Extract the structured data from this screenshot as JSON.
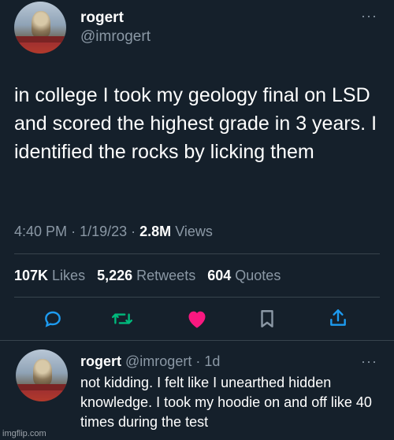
{
  "tweet": {
    "display_name": "rogert",
    "handle": "@imrogert",
    "more": "···",
    "text": "in college I took my geology final on LSD and scored the highest grade in 3 years. I identified the rocks by licking them",
    "time": "4:40 PM",
    "date": "1/19/23",
    "views_count": "2.8M",
    "views_label": "Views",
    "likes_count": "107K",
    "likes_label": "Likes",
    "retweets_count": "5,226",
    "retweets_label": "Retweets",
    "quotes_count": "604",
    "quotes_label": "Quotes"
  },
  "actions": {
    "icons": [
      "reply-icon",
      "retweet-icon",
      "like-icon",
      "bookmark-icon",
      "share-icon"
    ],
    "colors": {
      "reply": "#1d9bf0",
      "retweet": "#00ba7c",
      "like": "#f91880",
      "bookmark": "#8b98a5",
      "share": "#1d9bf0"
    }
  },
  "reply": {
    "display_name": "rogert",
    "handle": "@imrogert",
    "age": "1d",
    "more": "···",
    "text": "not kidding. I felt like I unearthed hidden knowledge. I took my hoodie on and off like 40 times during the test"
  },
  "watermark": "imgflip.com"
}
